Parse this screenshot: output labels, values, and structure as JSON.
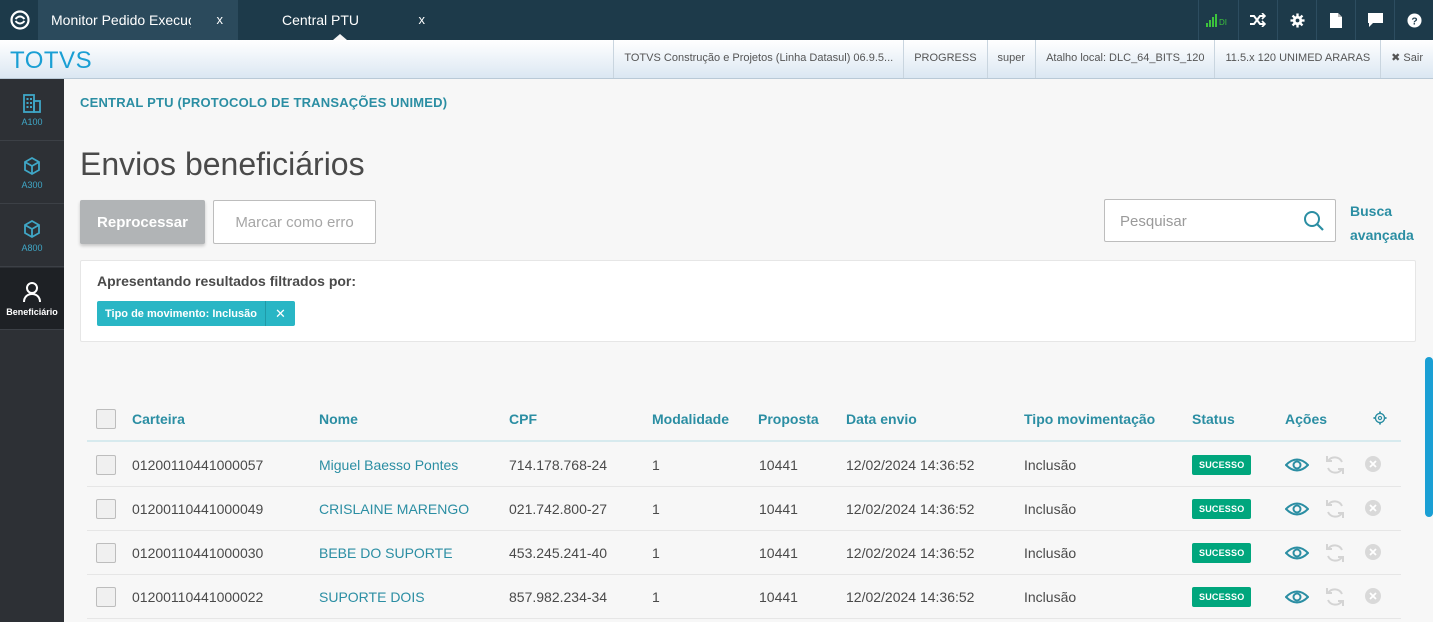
{
  "tabs": [
    {
      "label": "Monitor Pedido Execução",
      "close": "x"
    },
    {
      "label": "Central PTU",
      "close": "x"
    }
  ],
  "top_icons": [
    "signal-icon",
    "shuffle-icon",
    "gear-icon",
    "document-icon",
    "chat-icon",
    "help-icon"
  ],
  "signal_text": "DI",
  "brand": "TOTVS",
  "header_info": [
    "TOTVS Construção e Projetos (Linha Datasul) 06.9.5...",
    "PROGRESS",
    "super",
    "Atalho local: DLC_64_BITS_120",
    "11.5.x 120 UNIMED ARARAS"
  ],
  "logout_label": "✖ Sair",
  "sidebar": [
    {
      "label": "A100",
      "icon": "building-icon"
    },
    {
      "label": "A300",
      "icon": "cube-icon"
    },
    {
      "label": "A800",
      "icon": "cube-icon"
    },
    {
      "label": "Beneficiário",
      "icon": "user-icon"
    }
  ],
  "breadcrumb": "CENTRAL PTU (PROTOCOLO DE TRANSAÇÕES UNIMED)",
  "page_title": "Envios beneficiários",
  "actions": {
    "reprocess": "Reprocessar",
    "mark_error": "Marcar como erro"
  },
  "search": {
    "placeholder": "Pesquisar"
  },
  "advanced_search": [
    "Busca",
    "avançada"
  ],
  "filters": {
    "title": "Apresentando resultados filtrados por:",
    "chips": [
      {
        "label": "Tipo de movimento: Inclusão",
        "close": "✕"
      }
    ]
  },
  "table": {
    "columns": [
      "Carteira",
      "Nome",
      "CPF",
      "Modalidade",
      "Proposta",
      "Data envio",
      "Tipo movimentação",
      "Status",
      "Ações"
    ],
    "rows": [
      {
        "carteira": "01200110441000057",
        "nome": "Miguel Baesso Pontes",
        "cpf": "714.178.768-24",
        "modalidade": "1",
        "proposta": "10441",
        "data_envio": "12/02/2024 14:36:52",
        "tipo": "Inclusão",
        "status": "SUCESSO"
      },
      {
        "carteira": "01200110441000049",
        "nome": "CRISLAINE MARENGO",
        "cpf": "021.742.800-27",
        "modalidade": "1",
        "proposta": "10441",
        "data_envio": "12/02/2024 14:36:52",
        "tipo": "Inclusão",
        "status": "SUCESSO"
      },
      {
        "carteira": "01200110441000030",
        "nome": "BEBE DO SUPORTE",
        "cpf": "453.245.241-40",
        "modalidade": "1",
        "proposta": "10441",
        "data_envio": "12/02/2024 14:36:52",
        "tipo": "Inclusão",
        "status": "SUCESSO"
      },
      {
        "carteira": "01200110441000022",
        "nome": "SUPORTE DOIS",
        "cpf": "857.982.234-34",
        "modalidade": "1",
        "proposta": "10441",
        "data_envio": "12/02/2024 14:36:52",
        "tipo": "Inclusão",
        "status": "SUCESSO"
      }
    ]
  },
  "colors": {
    "accent": "#2b8ea3",
    "brand": "#1a9fd4",
    "success": "#00a67d",
    "chip": "#29b6c5",
    "topbar": "#1d3a4a",
    "sidebar": "#2d3035"
  }
}
